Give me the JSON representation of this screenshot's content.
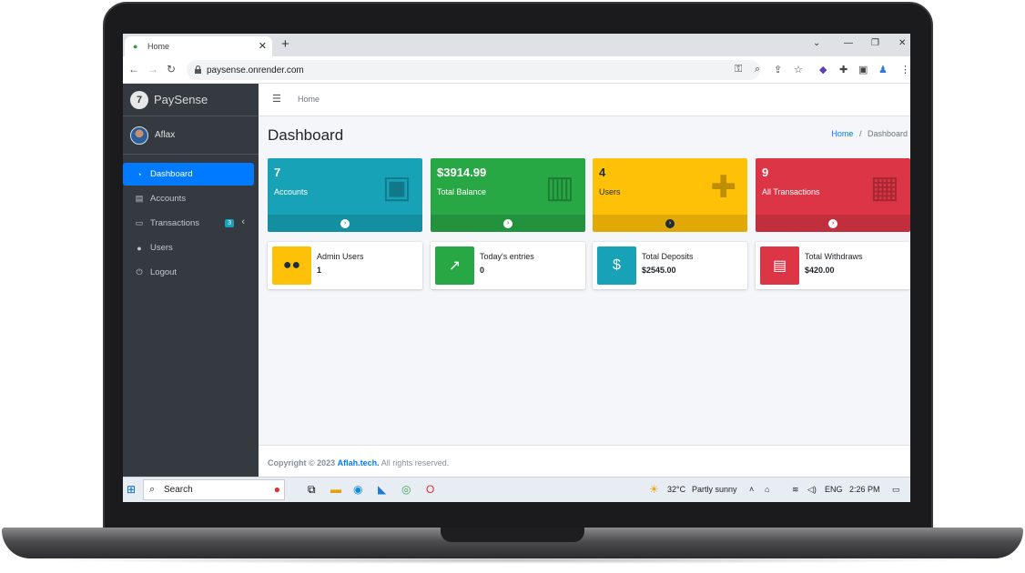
{
  "browser": {
    "tab_title": "Home",
    "new_tab": "+",
    "url": "paysense.onrender.com"
  },
  "sidebar": {
    "brand": "PaySense",
    "user_name": "Aflax",
    "items": [
      {
        "label": "Dashboard",
        "icon": "dashboard-icon"
      },
      {
        "label": "Accounts",
        "icon": "accounts-icon"
      },
      {
        "label": "Transactions",
        "icon": "transactions-icon",
        "badge": "3"
      },
      {
        "label": "Users",
        "icon": "user-icon"
      },
      {
        "label": "Logout",
        "icon": "power-icon"
      }
    ]
  },
  "topnav": {
    "home_link": "Home"
  },
  "page": {
    "title": "Dashboard",
    "breadcrumb_home": "Home",
    "breadcrumb_sep": "/",
    "breadcrumb_current": "Dashboard"
  },
  "stat_boxes": [
    {
      "value": "7",
      "label": "Accounts",
      "color": "#17a2b8",
      "icon": "id-card-icon"
    },
    {
      "value": "$3914.99",
      "label": "Total Balance",
      "color": "#28a745",
      "icon": "money-icon"
    },
    {
      "value": "4",
      "label": "Users",
      "color": "#ffc107",
      "icon": "user-plus-icon"
    },
    {
      "value": "9",
      "label": "All Transactions",
      "color": "#dc3545",
      "icon": "bar-chart-icon"
    }
  ],
  "info_boxes": [
    {
      "title": "Admin Users",
      "value": "1",
      "color": "#ffc107",
      "icon": "users-icon"
    },
    {
      "title": "Today's entries",
      "value": "0",
      "color": "#28a745",
      "icon": "trend-icon"
    },
    {
      "title": "Total Deposits",
      "value": "$2545.00",
      "color": "#17a2b8",
      "icon": "deposit-icon"
    },
    {
      "title": "Total Withdraws",
      "value": "$420.00",
      "color": "#dc3545",
      "icon": "cash-register-icon"
    }
  ],
  "footer": {
    "copyright": "Copyright © 2023",
    "company": "Aflah.tech.",
    "rights": "All rights reserved."
  },
  "taskbar": {
    "search": "Search",
    "weather_temp": "32°C",
    "weather_desc": "Partly sunny",
    "lang": "ENG",
    "time": "2:26 PM"
  }
}
